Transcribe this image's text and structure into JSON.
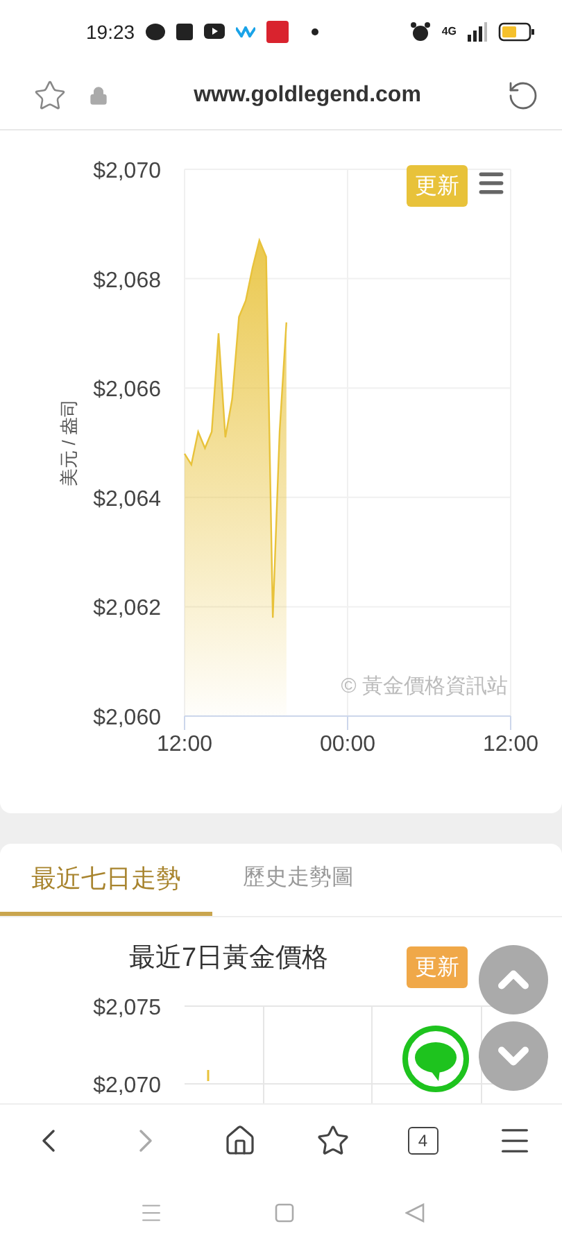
{
  "status_bar": {
    "time": "19:23",
    "network": "4G"
  },
  "address_bar": {
    "url": "www.goldlegend.com"
  },
  "intraday_chart": {
    "refresh_button": "更新",
    "credit": "© 黃金價格資訊站",
    "chart_data": {
      "type": "area",
      "grid": true,
      "ylabel": "美元 / 盎司",
      "ylim": [
        2060,
        2070
      ],
      "yticks": [
        {
          "value": 2060,
          "label": "$2,060"
        },
        {
          "value": 2062,
          "label": "$2,062"
        },
        {
          "value": 2064,
          "label": "$2,064"
        },
        {
          "value": 2066,
          "label": "$2,066"
        },
        {
          "value": 2068,
          "label": "$2,068"
        },
        {
          "value": 2070,
          "label": "$2,070"
        }
      ],
      "categories": [
        "12:00",
        null,
        null,
        null,
        null,
        null,
        null,
        null,
        null,
        null,
        null,
        null,
        null,
        null,
        null,
        null,
        null,
        null,
        null,
        null,
        null,
        null,
        null,
        null,
        "00:00",
        null,
        null,
        null,
        null,
        null,
        null,
        null,
        null,
        null,
        null,
        null,
        null,
        null,
        null,
        null,
        null,
        null,
        null,
        null,
        null,
        null,
        null,
        null,
        "12:00"
      ],
      "series": [
        {
          "color": "#e8c23a",
          "values": [
            2064.8,
            2064.6,
            2065.2,
            2064.9,
            2065.2,
            2067.0,
            2065.1,
            2065.8,
            2067.3,
            2067.6,
            2068.2,
            2068.7,
            2068.4,
            2061.8,
            2065.2,
            2067.2,
            null,
            null,
            null,
            null,
            null,
            null,
            null,
            null,
            null,
            null,
            null,
            null,
            null,
            null,
            null,
            null,
            null,
            null,
            null,
            null,
            null,
            null,
            null,
            null,
            null,
            null,
            null,
            null,
            null,
            null,
            null,
            null,
            null
          ]
        }
      ]
    }
  },
  "tabs": [
    {
      "label": "最近七日走勢",
      "selected": true
    },
    {
      "label": "歷史走勢圖",
      "selected": false
    }
  ],
  "weekly_chart": {
    "title": "最近7日黃金價格",
    "refresh_button": "更新",
    "y_axis_labels": [
      "$2,075",
      "$2,070"
    ]
  },
  "bottom_nav": {
    "tab_count": "4",
    "forward_disabled": true
  }
}
